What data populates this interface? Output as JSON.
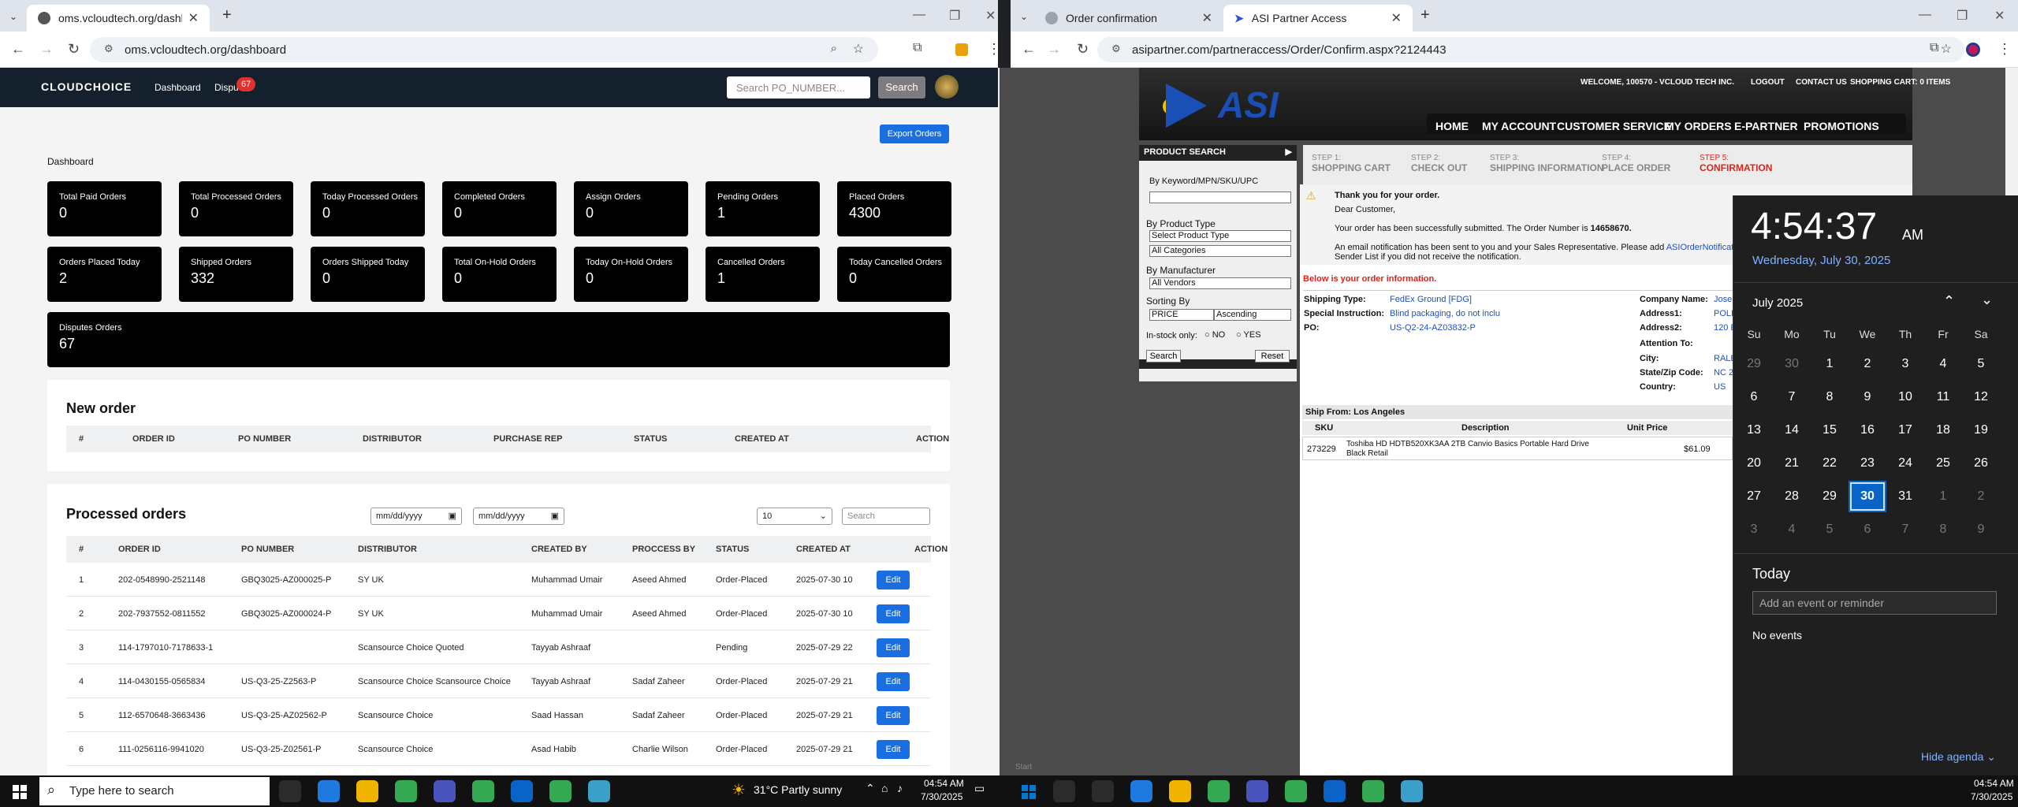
{
  "left_browser": {
    "tab_title": "oms.vcloudtech.org/dashboard",
    "url": "oms.vcloudtech.org/dashboard",
    "header": {
      "logo": "CLOUDCHOICE",
      "nav_dashboard": "Dashboard",
      "nav_disputes": "Dispu",
      "disputes_badge": "67",
      "search_placeholder": "Search PO_NUMBER...",
      "search_button": "Search"
    },
    "export_button": "Export Orders",
    "dashboard_title": "Dashboard",
    "cards_row1": [
      {
        "label": "Total Paid Orders",
        "value": "0"
      },
      {
        "label": "Total Processed Orders",
        "value": "0"
      },
      {
        "label": "Today Processed Orders",
        "value": "0"
      },
      {
        "label": "Completed Orders",
        "value": "0"
      },
      {
        "label": "Assign Orders",
        "value": "0"
      },
      {
        "label": "Pending Orders",
        "value": "1"
      },
      {
        "label": "Placed Orders",
        "value": "4300"
      }
    ],
    "cards_row2": [
      {
        "label": "Orders Placed Today",
        "value": "2"
      },
      {
        "label": "Shipped Orders",
        "value": "332"
      },
      {
        "label": "Orders Shipped Today",
        "value": "0"
      },
      {
        "label": "Total On-Hold Orders",
        "value": "0"
      },
      {
        "label": "Today On-Hold Orders",
        "value": "0"
      },
      {
        "label": "Cancelled Orders",
        "value": "1"
      },
      {
        "label": "Today Cancelled Orders",
        "value": "0"
      }
    ],
    "disputes_card": {
      "label": "Disputes Orders",
      "value": "67"
    },
    "new_order": {
      "title": "New order",
      "columns": [
        "#",
        "ORDER ID",
        "PO NUMBER",
        "DISTRIBUTOR",
        "PURCHASE REP",
        "STATUS",
        "CREATED AT",
        "ACTION"
      ]
    },
    "processed_orders": {
      "title": "Processed orders",
      "date_placeholder": "mm/dd/yyyy",
      "page_size": "10",
      "search_placeholder": "Search",
      "columns": [
        "#",
        "ORDER ID",
        "PO NUMBER",
        "DISTRIBUTOR",
        "CREATED BY",
        "PROCCESS BY",
        "STATUS",
        "CREATED AT",
        "ACTION"
      ],
      "edit_label": "Edit",
      "rows": [
        [
          "1",
          "202-0548990-2521148",
          "GBQ3025-AZ000025-P",
          "SY UK",
          "Muhammad Umair",
          "Aseed Ahmed",
          "Order-Placed",
          "2025-07-30 10"
        ],
        [
          "2",
          "202-7937552-0811552",
          "GBQ3025-AZ000024-P",
          "SY UK",
          "Muhammad Umair",
          "Aseed Ahmed",
          "Order-Placed",
          "2025-07-30 10"
        ],
        [
          "3",
          "114-1797010-7178633-1",
          "",
          "Scansource Choice Quoted",
          "Tayyab Ashraaf",
          "",
          "Pending",
          "2025-07-29 22"
        ],
        [
          "4",
          "114-0430155-0565834",
          "US-Q3-25-Z2563-P",
          "Scansource Choice Scansource Choice",
          "Tayyab Ashraaf",
          "Sadaf Zaheer",
          "Order-Placed",
          "2025-07-29 21"
        ],
        [
          "5",
          "112-6570648-3663436",
          "US-Q3-25-AZ02562-P",
          "Scansource Choice",
          "Saad Hassan",
          "Sadaf Zaheer",
          "Order-Placed",
          "2025-07-29 21"
        ],
        [
          "6",
          "111-0256116-9941020",
          "US-Q3-25-Z02561-P",
          "Scansource Choice",
          "Asad Habib",
          "Charlie Wilson",
          "Order-Placed",
          "2025-07-29 21"
        ]
      ]
    }
  },
  "right_browser": {
    "tabs": [
      "Order confirmation",
      "ASI Partner Access"
    ],
    "url": "asipartner.com/partneraccess/Order/Confirm.aspx?2124443",
    "asi": {
      "logo": "ASI",
      "top_links": [
        "WELCOME, 100570 - VCLOUD TECH INC.",
        "LOGOUT",
        "CONTACT US",
        "SHOPPING CART: 0 ITEMS"
      ],
      "nav": [
        "HOME",
        "MY ACCOUNT",
        "CUSTOMER SERVICE",
        "MY ORDERS",
        "E-PARTNER",
        "PROMOTIONS"
      ],
      "product_search": "PRODUCT SEARCH",
      "keyword_label": "By Keyword/MPN/SKU/UPC",
      "by_product_type": "By Product Type",
      "select_product_type": "Select Product Type",
      "all_categories": "All Categories",
      "by_manufacturer": "By Manufacturer",
      "all_vendors": "All Vendors",
      "sorting_by": "Sorting By",
      "sort_price": "PRICE",
      "sort_order": "Ascending",
      "instock_label": "In-stock only:",
      "no": "NO",
      "yes": "YES",
      "search_btn": "Search",
      "reset_btn": "Reset",
      "steps": [
        {
          "n": "STEP 1:",
          "t": "SHOPPING CART"
        },
        {
          "n": "STEP 2:",
          "t": "CHECK OUT"
        },
        {
          "n": "STEP 3:",
          "t": "SHIPPING INFORMATION"
        },
        {
          "n": "STEP 4:",
          "t": "PLACE ORDER"
        },
        {
          "n": "STEP 5:",
          "t": "CONFIRMATION"
        }
      ],
      "thank_you": "Thank you for your order.",
      "dear": "Dear Customer,",
      "submitted_prefix": "Your order has been successfully submitted. The Order Number is",
      "order_number": "14658670.",
      "email_note": "An email notification has been sent to you and your Sales Representative. Please add",
      "email_link": "ASIOrderNotificat",
      "email_note2": "Sender List if you did not receive the notification.",
      "below_info": "Below is your order information.",
      "shipping_type_label": "Shipping Type:",
      "shipping_type": "FedEx Ground [FDG]",
      "special_label": "Special Instruction:",
      "special": "Blind packaging, do not inclu",
      "po_label": "PO:",
      "po": "US-Q2-24-AZ03832-P",
      "company_label": "Company Name:",
      "company": "Jose",
      "address1_label": "Address1:",
      "address1": "POLK",
      "address2_label": "Address2:",
      "address2": "120 B",
      "attention_label": "Attention To:",
      "city_label": "City:",
      "city": "RALE",
      "state_label": "State/Zip Code:",
      "state": "NC 2",
      "country_label": "Country:",
      "country": "US",
      "ship_from": "Ship From: Los Angeles",
      "item_cols": [
        "SKU",
        "Description",
        "Unit Price"
      ],
      "item": {
        "sku": "273229",
        "desc1": "Toshiba HD HDTB520XK3AA 2TB Canvio Basics Portable Hard Drive",
        "desc2": "Black Retail",
        "price": "$61.09"
      }
    },
    "start_label": "Start"
  },
  "calendar": {
    "time": "4:54:37",
    "ampm": "AM",
    "date": "Wednesday, July 30, 2025",
    "month": "July 2025",
    "dow": [
      "Su",
      "Mo",
      "Tu",
      "We",
      "Th",
      "Fr",
      "Sa"
    ],
    "weeks": [
      [
        "29",
        "30",
        "1",
        "2",
        "3",
        "4",
        "5"
      ],
      [
        "6",
        "7",
        "8",
        "9",
        "10",
        "11",
        "12"
      ],
      [
        "13",
        "14",
        "15",
        "16",
        "17",
        "18",
        "19"
      ],
      [
        "20",
        "21",
        "22",
        "23",
        "24",
        "25",
        "26"
      ],
      [
        "27",
        "28",
        "29",
        "30",
        "31",
        "1",
        "2"
      ],
      [
        "3",
        "4",
        "5",
        "6",
        "7",
        "8",
        "9"
      ]
    ],
    "today_label": "Today",
    "event_placeholder": "Add an event or reminder",
    "no_events": "No events",
    "hide_agenda": "Hide agenda"
  },
  "taskbar": {
    "search_placeholder": "Type here to search",
    "weather": "31°C  Partly sunny",
    "time": "04:54 AM",
    "date": "7/30/2025"
  },
  "colors": {
    "accent": "#1a6fe0",
    "asi_red": "#d9261c",
    "today_blue": "#0a64c8"
  }
}
